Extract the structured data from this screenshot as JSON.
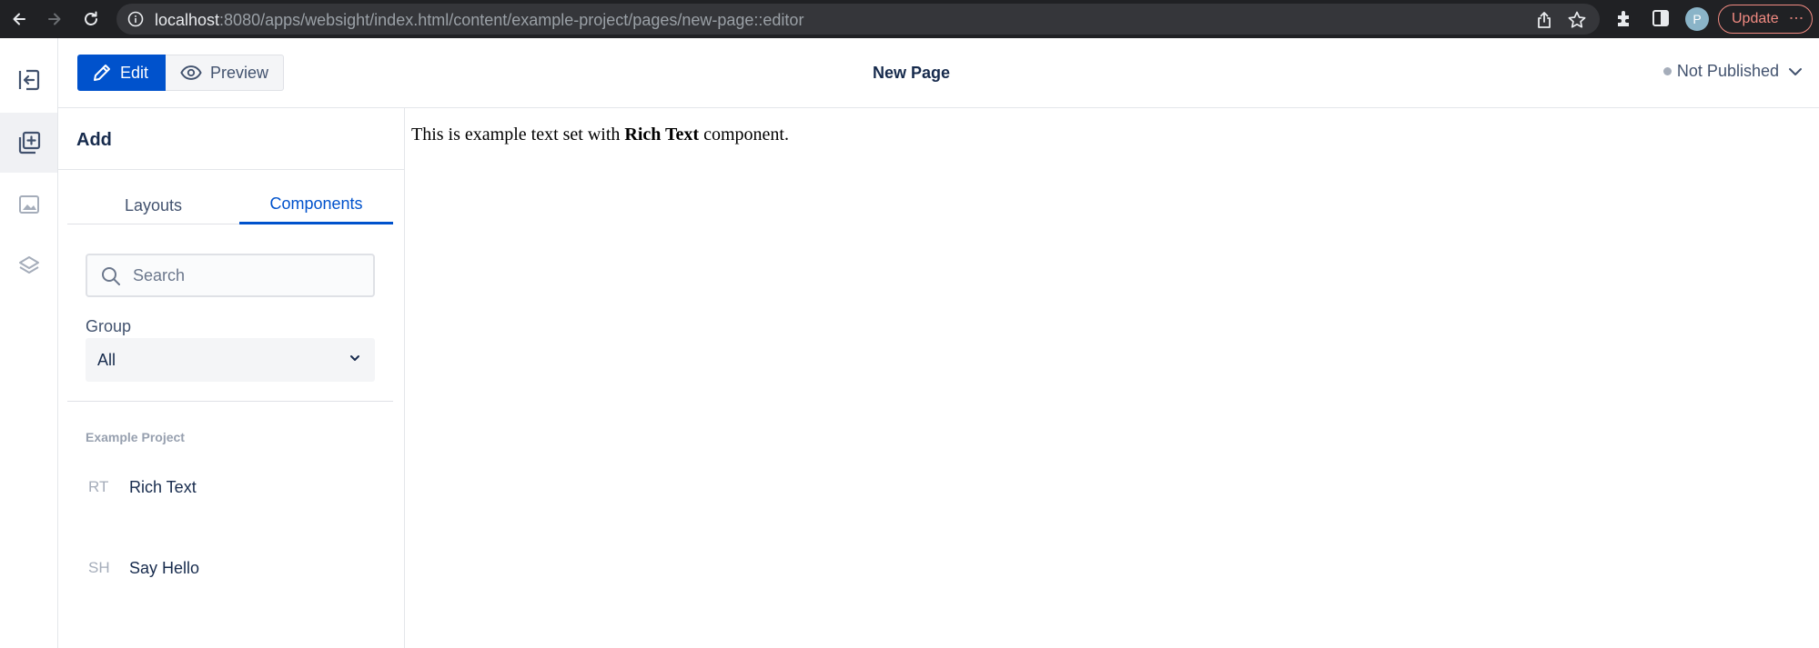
{
  "browser": {
    "url_host": "localhost",
    "url_path": ":8080/apps/websight/index.html/content/example-project/pages/new-page::editor",
    "profile_initial": "P",
    "update_label": "Update"
  },
  "rail": {
    "items": [
      {
        "icon": "exit-icon"
      },
      {
        "icon": "add-component-icon",
        "active": true
      },
      {
        "icon": "image-icon"
      },
      {
        "icon": "layers-icon"
      }
    ]
  },
  "toolbar": {
    "edit_label": "Edit",
    "preview_label": "Preview",
    "page_title": "New Page",
    "publish_status": "Not Published"
  },
  "panel": {
    "title": "Add",
    "tabs": [
      {
        "label": "Layouts",
        "active": false
      },
      {
        "label": "Components",
        "active": true
      }
    ],
    "search_placeholder": "Search",
    "group_label": "Group",
    "group_value": "All",
    "section_label": "Example Project",
    "components": [
      {
        "abbr": "RT",
        "name": "Rich Text"
      },
      {
        "abbr": "SH",
        "name": "Say Hello"
      }
    ]
  },
  "canvas": {
    "text_before": "This is example text set with ",
    "text_bold": "Rich Text",
    "text_after": " component."
  },
  "colors": {
    "accent": "#0052cc",
    "browser_bar": "#202124",
    "update": "#f28b82"
  }
}
